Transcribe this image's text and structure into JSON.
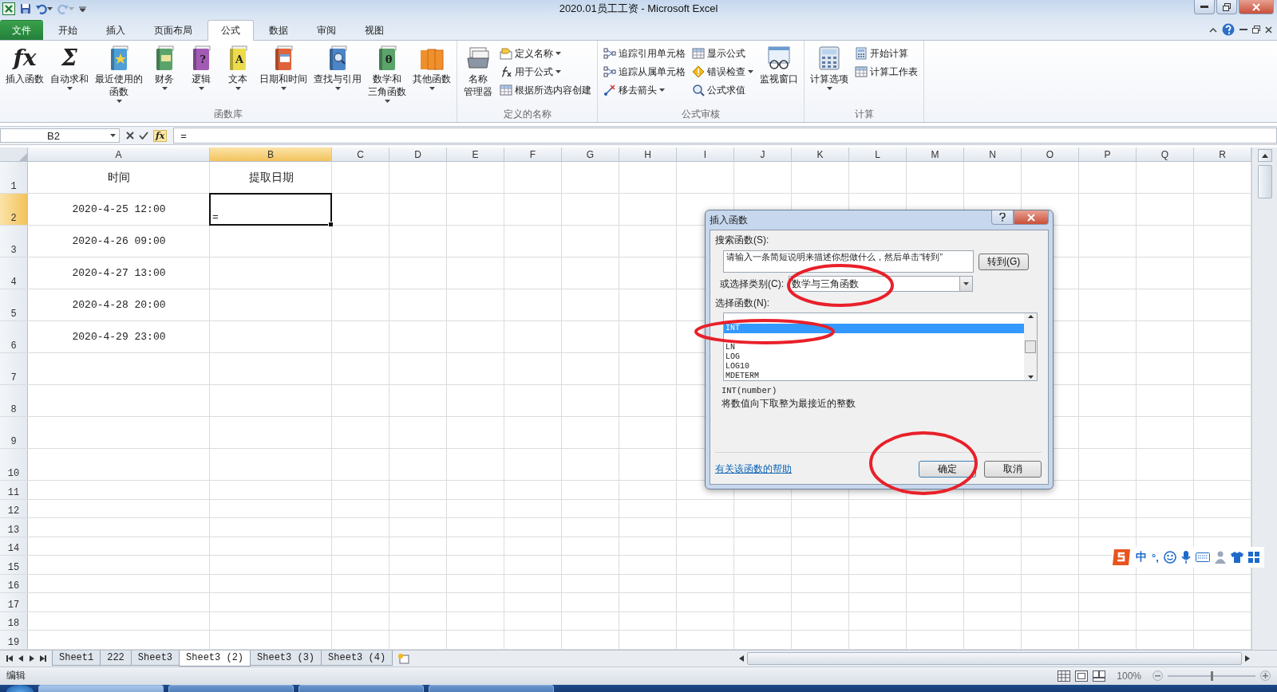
{
  "title_bar": {
    "title": "2020.01员工工资 - Microsoft Excel",
    "quick_access": [
      {
        "kind": "save",
        "disabled": false
      },
      {
        "kind": "undo",
        "disabled": false
      },
      {
        "kind": "redo",
        "disabled": true
      }
    ]
  },
  "ribbon": {
    "tabs": [
      {
        "label": "文件",
        "kind": "file",
        "selected": false
      },
      {
        "label": "开始",
        "kind": "tab",
        "selected": false
      },
      {
        "label": "插入",
        "kind": "tab",
        "selected": false
      },
      {
        "label": "页面布局",
        "kind": "tab",
        "selected": false
      },
      {
        "label": "公式",
        "kind": "tab",
        "selected": true
      },
      {
        "label": "数据",
        "kind": "tab",
        "selected": false
      },
      {
        "label": "审阅",
        "kind": "tab",
        "selected": false
      },
      {
        "label": "视图",
        "kind": "tab",
        "selected": false
      }
    ],
    "groups": [
      {
        "label": "函数库",
        "items": [
          {
            "lines": [
              "插入函数"
            ],
            "glyph": "fx",
            "dropdown": false
          },
          {
            "lines": [
              "自动求和"
            ],
            "glyph": "Σ",
            "dropdown": true
          },
          {
            "lines": [
              "最近使用的",
              "函数"
            ],
            "color": "#4f9fd6",
            "dropdown": true
          },
          {
            "lines": [
              "财务"
            ],
            "color": "#5aa36a",
            "dropdown": true
          },
          {
            "lines": [
              "逻辑"
            ],
            "color": "#a25bb5",
            "glyph": "?",
            "dropdown": true
          },
          {
            "lines": [
              "文本"
            ],
            "color": "#ecdc4c",
            "glyph": "A",
            "dropdown": true
          },
          {
            "lines": [
              "日期和时间"
            ],
            "color": "#e0633c",
            "dropdown": true
          },
          {
            "lines": [
              "查找与引用"
            ],
            "color": "#4a86c8",
            "dropdown": true
          },
          {
            "lines": [
              "数学和",
              "三角函数"
            ],
            "color": "#5aa36a",
            "glyph": "θ",
            "dropdown": true
          },
          {
            "lines": [
              "其他函数"
            ],
            "color": "#f0902c",
            "dropdown": true
          }
        ]
      },
      {
        "label": "定义的名称",
        "items": [
          {
            "lines": [
              "名称",
              "管理器"
            ],
            "dropdown": false
          },
          {
            "stack": [
              {
                "label": "定义名称",
                "dropdown": true
              },
              {
                "label": "用于公式",
                "dropdown": true
              },
              {
                "label": "根据所选内容创建",
                "dropdown": false
              }
            ]
          }
        ]
      },
      {
        "label": "公式审核",
        "items": [
          {
            "stack": [
              {
                "label": "追踪引用单元格",
                "dropdown": false
              },
              {
                "label": "追踪从属单元格",
                "dropdown": false
              },
              {
                "label": "移去箭头",
                "dropdown": true
              }
            ]
          },
          {
            "stack": [
              {
                "label": "显示公式",
                "dropdown": false
              },
              {
                "label": "错误检查",
                "dropdown": true
              },
              {
                "label": "公式求值",
                "dropdown": false
              }
            ]
          },
          {
            "lines": [
              "监视窗口"
            ],
            "dropdown": false
          }
        ]
      },
      {
        "label": "计算",
        "items": [
          {
            "lines": [
              "计算选项"
            ],
            "dropdown": true
          },
          {
            "stack": [
              {
                "label": "开始计算",
                "dropdown": false
              },
              {
                "label": "计算工作表",
                "dropdown": false
              }
            ]
          }
        ]
      }
    ]
  },
  "formula_bar": {
    "name_box": "B2",
    "glyph": "fx",
    "formula": "="
  },
  "sheet": {
    "columns": [
      {
        "label": "A",
        "selected": false
      },
      {
        "label": "B",
        "selected": true
      },
      {
        "label": "C",
        "selected": false
      },
      {
        "label": "D",
        "selected": false
      },
      {
        "label": "E",
        "selected": false
      },
      {
        "label": "F",
        "selected": false
      },
      {
        "label": "G",
        "selected": false
      },
      {
        "label": "H",
        "selected": false
      },
      {
        "label": "I",
        "selected": false
      },
      {
        "label": "J",
        "selected": false
      },
      {
        "label": "K",
        "selected": false
      },
      {
        "label": "L",
        "selected": false
      },
      {
        "label": "M",
        "selected": false
      },
      {
        "label": "N",
        "selected": false
      },
      {
        "label": "O",
        "selected": false
      },
      {
        "label": "P",
        "selected": false
      },
      {
        "label": "Q",
        "selected": false
      },
      {
        "label": "R",
        "selected": false
      }
    ],
    "rows": [
      {
        "label": "1",
        "selected": false,
        "cells": [
          {
            "text": "时间",
            "active": false
          },
          {
            "text": "提取日期",
            "active": false
          }
        ]
      },
      {
        "label": "2",
        "selected": true,
        "cells": [
          {
            "text": "2020-4-25 12:00",
            "active": false
          },
          {
            "text": "=",
            "active": true
          }
        ]
      },
      {
        "label": "3",
        "selected": false,
        "cells": [
          {
            "text": "2020-4-26 09:00",
            "active": false
          }
        ]
      },
      {
        "label": "4",
        "selected": false,
        "cells": [
          {
            "text": "2020-4-27 13:00",
            "active": false
          }
        ]
      },
      {
        "label": "5",
        "selected": false,
        "cells": [
          {
            "text": "2020-4-28 20:00",
            "active": false
          }
        ]
      },
      {
        "label": "6",
        "selected": false,
        "cells": [
          {
            "text": "2020-4-29 23:00",
            "active": false
          }
        ]
      },
      {
        "label": "7",
        "selected": false
      },
      {
        "label": "8",
        "selected": false
      },
      {
        "label": "9",
        "selected": false
      },
      {
        "label": "10",
        "selected": false
      },
      {
        "label": "11",
        "selected": false
      },
      {
        "label": "12",
        "selected": false
      },
      {
        "label": "13",
        "selected": false
      },
      {
        "label": "14",
        "selected": false
      },
      {
        "label": "15",
        "selected": false
      },
      {
        "label": "16",
        "selected": false
      },
      {
        "label": "17",
        "selected": false
      },
      {
        "label": "18",
        "selected": false
      },
      {
        "label": "19",
        "selected": false
      }
    ]
  },
  "dialog": {
    "title": "插入函数",
    "search_label": "搜索函数(S):",
    "search_value": "请输入一条简短说明来描述你想做什么，然后单击“转到”",
    "go_button": "转到(G)",
    "category_label": "或选择类别(C):",
    "category_value": "数学与三角函数",
    "function_label": "选择函数(N):",
    "functions": [
      {
        "name": "INT",
        "selected": true
      },
      {
        "name": "LN",
        "selected": false
      },
      {
        "name": "LOG",
        "selected": false
      },
      {
        "name": "LOG10",
        "selected": false
      },
      {
        "name": "MDETERM",
        "selected": false
      }
    ],
    "signature": "INT(number)",
    "description": "将数值向下取整为最接近的整数",
    "help_link": "有关该函数的帮助",
    "ok_button": "确定",
    "cancel_button": "取消"
  },
  "sheet_tabs": [
    {
      "label": "Sheet1",
      "selected": false
    },
    {
      "label": "222",
      "selected": false
    },
    {
      "label": "Sheet3",
      "selected": false
    },
    {
      "label": "Sheet3 (2)",
      "selected": true
    },
    {
      "label": "Sheet3 (3)",
      "selected": false
    },
    {
      "label": "Sheet3 (4)",
      "selected": false
    }
  ],
  "status_bar": {
    "mode": "编辑",
    "zoom": "100%",
    "zoom_slider": {
      "level": 0.5
    }
  },
  "ime_bar": {
    "mode": "中",
    "punctuation": "°,"
  }
}
